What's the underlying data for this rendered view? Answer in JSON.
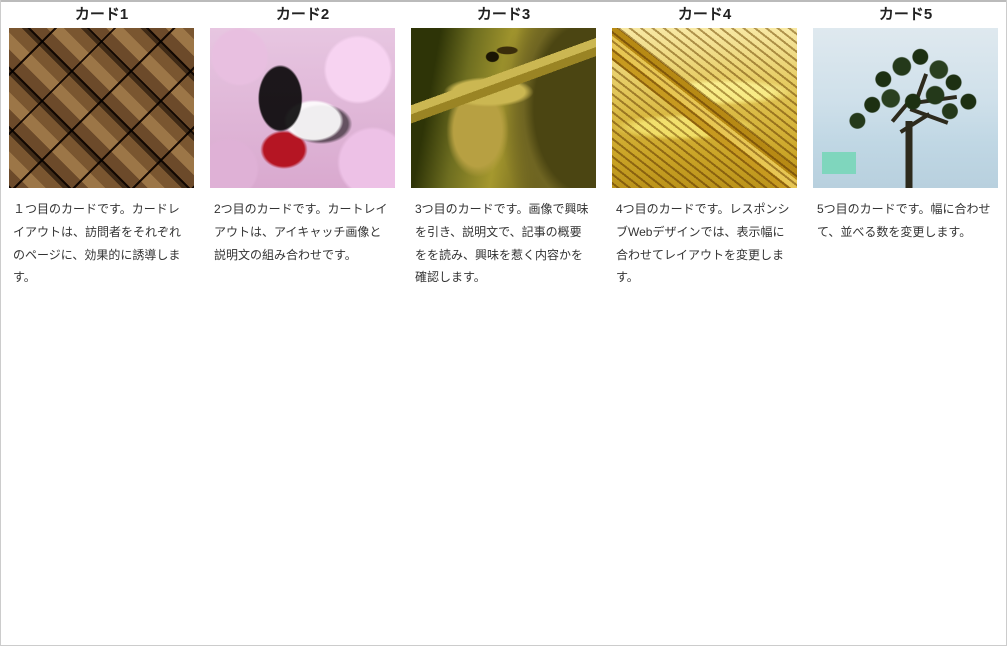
{
  "cards": [
    {
      "title": "カード1",
      "image_name": "woven-straw",
      "desc": "１つ目のカードです。カードレイアウトは、訪問者をそれぞれのページに、効果的に誘導します。"
    },
    {
      "title": "カード2",
      "image_name": "butterfly-on-pink-flowers",
      "desc": "2つ目のカードです。カートレイアウトは、アイキャッチ画像と説明文の組み合わせです。"
    },
    {
      "title": "カード3",
      "image_name": "sea-dragon",
      "desc": "3つ目のカードです。画像で興味を引き、説明文で、記事の概要をを読み、興味を惹く内容かを確認します。"
    },
    {
      "title": "カード4",
      "image_name": "wheat-ear",
      "desc": "4つ目のカードです。レスポンシブWebデザインでは、表示幅に合わせてレイアウトを変更します。"
    },
    {
      "title": "カード5",
      "image_name": "pine-tree",
      "desc": "5つ目のカードです。幅に合わせて、並べる数を変更します。"
    }
  ]
}
